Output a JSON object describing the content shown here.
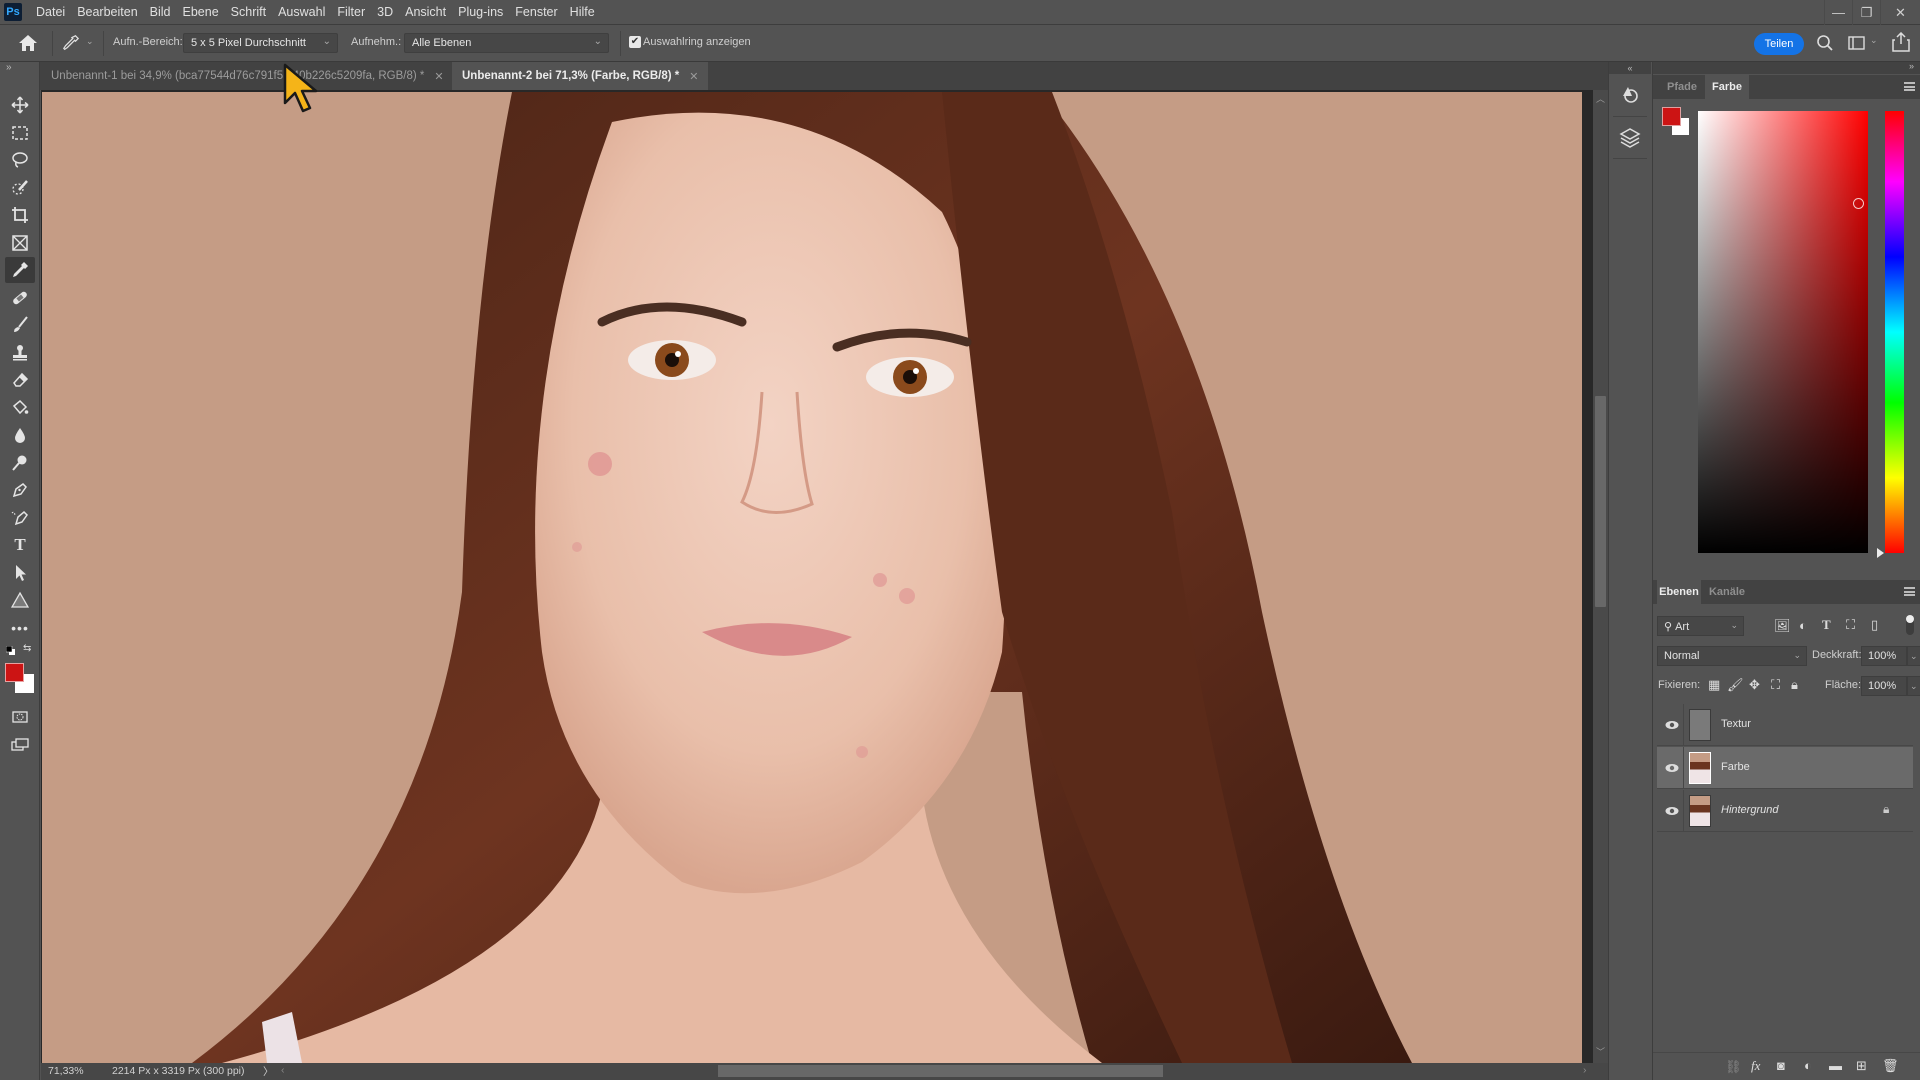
{
  "app": {
    "logo": "Ps",
    "name": "Adobe Photoshop"
  },
  "menu": [
    "Datei",
    "Bearbeiten",
    "Bild",
    "Ebene",
    "Schrift",
    "Auswahl",
    "Filter",
    "3D",
    "Ansicht",
    "Plug-ins",
    "Fenster",
    "Hilfe"
  ],
  "window_controls": {
    "minimize": "—",
    "restore": "❐",
    "close": "✕"
  },
  "options_bar": {
    "home_icon": "home-icon",
    "tool_icon": "eyedropper-icon",
    "sample_size_label": "Aufn.-Bereich:",
    "sample_size_value": "5 x 5 Pixel Durchschnitt",
    "sample_label": "Aufnehm.:",
    "sample_value": "Alle Ebenen",
    "show_ring_checked": true,
    "show_ring_label": "Auswahlring anzeigen",
    "share_label": "Teilen"
  },
  "tabs": [
    {
      "label": "Unbenannt-1 bei 34,9% (bca77544d76c791f5...40b226c5209fa, RGB/8) *",
      "active": false
    },
    {
      "label": "Unbenannt-2 bei 71,3% (Farbe, RGB/8) *",
      "active": true
    }
  ],
  "tools": [
    "move",
    "marquee",
    "lasso",
    "quick-selection",
    "crop",
    "frame",
    "eyedropper",
    "healing-brush",
    "brush",
    "clone-stamp",
    "eraser",
    "paint-bucket",
    "blur",
    "dodge",
    "pen",
    "freeform-pen",
    "type",
    "path-selection",
    "shape",
    "more"
  ],
  "active_tool": "eyedropper",
  "colors": {
    "foreground": "#cc1414",
    "background": "#ffffff",
    "accent": "#1473e6"
  },
  "status": {
    "zoom": "71,33%",
    "doc_info": "2214 Px x 3319 Px (300 ppi)",
    "arrow": "〉"
  },
  "color_panel": {
    "tabs": [
      {
        "label": "Pfade",
        "active": false
      },
      {
        "label": "Farbe",
        "active": true
      }
    ],
    "hue": "red"
  },
  "layers_panel": {
    "tabs": [
      {
        "label": "Ebenen",
        "active": true
      },
      {
        "label": "Kanäle",
        "active": false
      }
    ],
    "filter_label": "Art",
    "blend_mode": "Normal",
    "opacity_label": "Deckkraft:",
    "opacity_value": "100%",
    "lock_label": "Fixieren:",
    "fill_label": "Fläche:",
    "fill_value": "100%",
    "layers": [
      {
        "name": "Textur",
        "visible": true,
        "selected": false,
        "locked": false,
        "italic": false
      },
      {
        "name": "Farbe",
        "visible": true,
        "selected": true,
        "locked": false,
        "italic": false
      },
      {
        "name": "Hintergrund",
        "visible": true,
        "selected": false,
        "locked": true,
        "italic": true
      }
    ]
  }
}
